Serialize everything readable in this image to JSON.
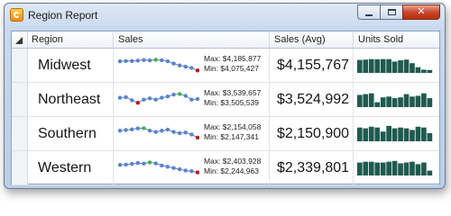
{
  "window": {
    "title": "Region Report"
  },
  "columns": {
    "region": "Region",
    "sales": "Sales",
    "avg": "Sales (Avg)",
    "units": "Units Sold"
  },
  "colors": {
    "bar": "#1f5a4f",
    "line": "#5a83c9",
    "high": "#39b54a",
    "low": "#c0141d"
  },
  "rows": [
    {
      "region": "Midwest",
      "max": "Max: $4,185,877",
      "min": "Min: $4,075,427",
      "avg": "$4,155,767",
      "sparkline": [
        0.78,
        0.8,
        0.8,
        0.83,
        0.88,
        0.85,
        0.9,
        0.86,
        0.78,
        0.6,
        0.45,
        0.35,
        0.25,
        0.05
      ],
      "units": [
        0.8,
        0.82,
        0.85,
        0.84,
        0.85,
        0.85,
        0.7,
        0.78,
        0.82,
        0.6,
        0.35,
        0.2,
        0.18
      ]
    },
    {
      "region": "Northeast",
      "max": "Max: $3,539,657",
      "min": "Min: $3,505,539",
      "avg": "$3,524,992",
      "sparkline": [
        0.6,
        0.65,
        0.4,
        0.2,
        0.45,
        0.55,
        0.45,
        0.6,
        0.7,
        0.85,
        0.9,
        0.75,
        0.45,
        0.5
      ],
      "units": [
        0.75,
        0.8,
        0.85,
        0.3,
        0.6,
        0.65,
        0.55,
        0.6,
        0.8,
        0.65,
        0.7,
        0.85,
        0.55
      ]
    },
    {
      "region": "Southern",
      "max": "Max: $2,154,058",
      "min": "Min: $2,147,341",
      "avg": "$2,150,900",
      "sparkline": [
        0.7,
        0.75,
        0.8,
        0.88,
        0.9,
        0.7,
        0.6,
        0.7,
        0.78,
        0.6,
        0.5,
        0.55,
        0.4,
        0.15
      ],
      "units": [
        0.85,
        0.8,
        0.9,
        0.85,
        0.6,
        0.95,
        0.8,
        0.85,
        0.8,
        0.7,
        0.9,
        0.85,
        0.5
      ]
    },
    {
      "region": "Western",
      "max": "Max: $2,403,928",
      "min": "Min: $2,244,963",
      "avg": "$2,339,801",
      "sparkline": [
        0.7,
        0.72,
        0.78,
        0.85,
        0.8,
        0.9,
        0.82,
        0.65,
        0.55,
        0.45,
        0.35,
        0.25,
        0.2,
        0.1
      ],
      "units": [
        0.8,
        0.85,
        0.85,
        0.8,
        0.8,
        0.85,
        0.9,
        0.75,
        0.8,
        0.85,
        0.7,
        0.8,
        0.3
      ]
    }
  ]
}
